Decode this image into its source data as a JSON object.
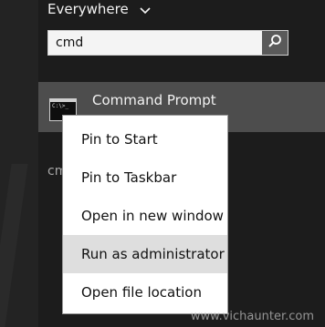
{
  "scope": {
    "label": "Everywhere"
  },
  "search": {
    "value": "cmd"
  },
  "result": {
    "title": "Command Prompt",
    "thumb_text": "C:\\>_"
  },
  "below_partial": "cm",
  "context_menu": {
    "items": [
      {
        "label": "Pin to Start"
      },
      {
        "label": "Pin to Taskbar"
      },
      {
        "label": "Open in new window"
      },
      {
        "label": "Run as administrator"
      },
      {
        "label": "Open file location"
      }
    ],
    "highlighted_index": 3
  },
  "watermark": "www.vichaunter.com",
  "colors": {
    "background": "#1c1c1c",
    "result_bg": "#4d4d4d",
    "search_button": "#5a5a5a",
    "menu_bg": "#ffffff",
    "menu_highlight": "#dedede"
  }
}
